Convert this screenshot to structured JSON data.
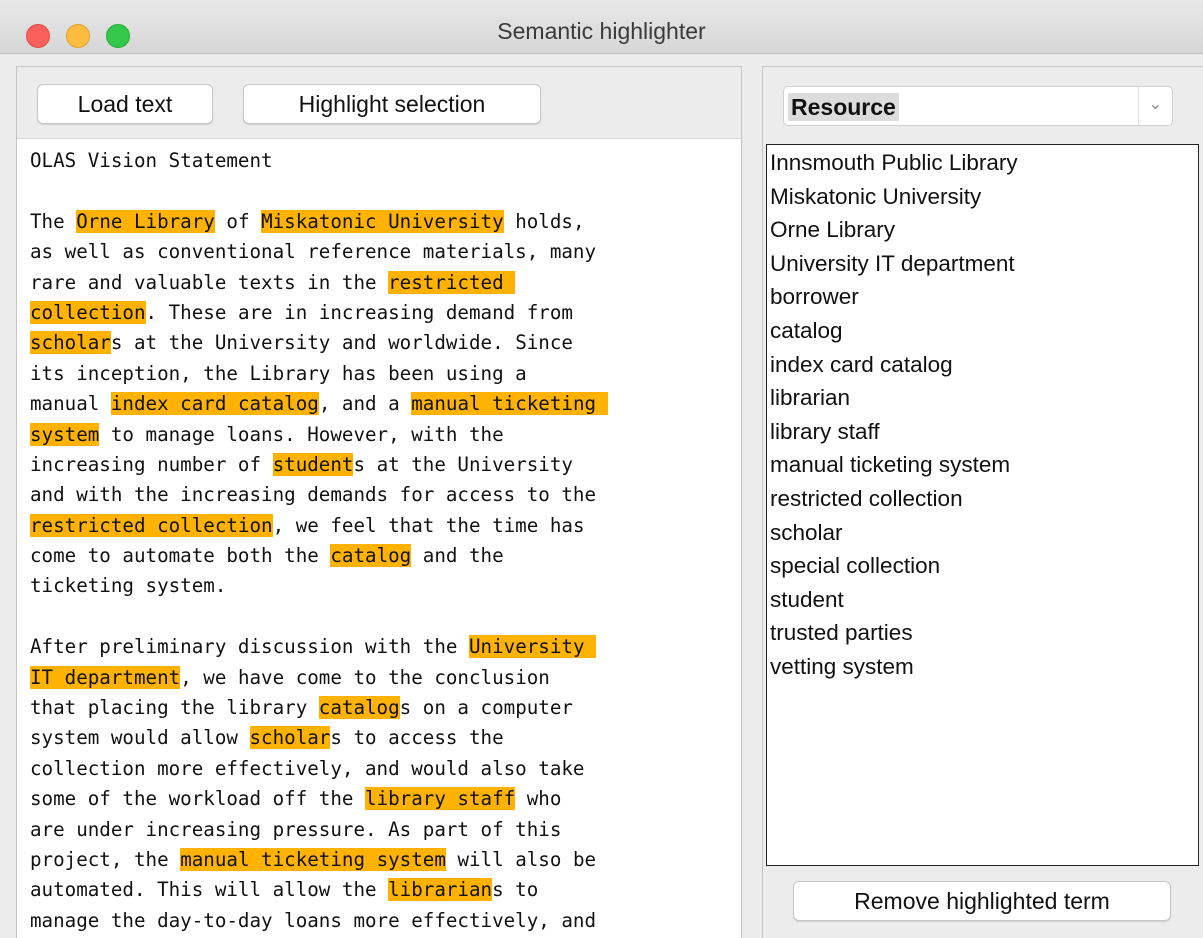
{
  "window": {
    "title": "Semantic highlighter"
  },
  "toolbar": {
    "load_label": "Load text",
    "highlight_label": "Highlight selection"
  },
  "document": {
    "highlight_color": "#ffb300",
    "lines": [
      [
        {
          "t": "OLAS Vision Statement",
          "h": false
        }
      ],
      [
        {
          "t": "",
          "h": false
        }
      ],
      [
        {
          "t": "The ",
          "h": false
        },
        {
          "t": "Orne Library",
          "h": true
        },
        {
          "t": " of ",
          "h": false
        },
        {
          "t": "Miskatonic University",
          "h": true
        },
        {
          "t": " holds,",
          "h": false
        }
      ],
      [
        {
          "t": "as well as conventional reference materials, many",
          "h": false
        }
      ],
      [
        {
          "t": "rare and valuable texts in the ",
          "h": false
        },
        {
          "t": "restricted ",
          "h": true
        }
      ],
      [
        {
          "t": "collection",
          "h": true
        },
        {
          "t": ". These are in increasing demand from",
          "h": false
        }
      ],
      [
        {
          "t": "scholar",
          "h": true
        },
        {
          "t": "s at the University and worldwide. Since",
          "h": false
        }
      ],
      [
        {
          "t": "its inception, the Library has been using a",
          "h": false
        }
      ],
      [
        {
          "t": "manual ",
          "h": false
        },
        {
          "t": "index card catalog",
          "h": true
        },
        {
          "t": ", and a ",
          "h": false
        },
        {
          "t": "manual ticketing ",
          "h": true
        }
      ],
      [
        {
          "t": "system",
          "h": true
        },
        {
          "t": " to manage loans. However, with the",
          "h": false
        }
      ],
      [
        {
          "t": "increasing number of ",
          "h": false
        },
        {
          "t": "student",
          "h": true
        },
        {
          "t": "s at the University",
          "h": false
        }
      ],
      [
        {
          "t": "and with the increasing demands for access to the",
          "h": false
        }
      ],
      [
        {
          "t": "restricted collection",
          "h": true
        },
        {
          "t": ", we feel that the time has",
          "h": false
        }
      ],
      [
        {
          "t": "come to automate both the ",
          "h": false
        },
        {
          "t": "catalog",
          "h": true
        },
        {
          "t": " and the",
          "h": false
        }
      ],
      [
        {
          "t": "ticketing system.",
          "h": false
        }
      ],
      [
        {
          "t": "",
          "h": false
        }
      ],
      [
        {
          "t": "After preliminary discussion with the ",
          "h": false
        },
        {
          "t": "University ",
          "h": true
        }
      ],
      [
        {
          "t": "IT department",
          "h": true
        },
        {
          "t": ", we have come to the conclusion",
          "h": false
        }
      ],
      [
        {
          "t": "that placing the library ",
          "h": false
        },
        {
          "t": "catalog",
          "h": true
        },
        {
          "t": "s on a computer",
          "h": false
        }
      ],
      [
        {
          "t": "system would allow ",
          "h": false
        },
        {
          "t": "scholar",
          "h": true
        },
        {
          "t": "s to access the",
          "h": false
        }
      ],
      [
        {
          "t": "collection more effectively, and would also take",
          "h": false
        }
      ],
      [
        {
          "t": "some of the workload off the ",
          "h": false
        },
        {
          "t": "library staff",
          "h": true
        },
        {
          "t": " who",
          "h": false
        }
      ],
      [
        {
          "t": "are under increasing pressure. As part of this",
          "h": false
        }
      ],
      [
        {
          "t": "project, the ",
          "h": false
        },
        {
          "t": "manual ticketing system",
          "h": true
        },
        {
          "t": " will also be",
          "h": false
        }
      ],
      [
        {
          "t": "automated. This will allow the ",
          "h": false
        },
        {
          "t": "librarian",
          "h": true
        },
        {
          "t": "s to",
          "h": false
        }
      ],
      [
        {
          "t": "manage the day-to-day loans more effectively, and",
          "h": false
        }
      ]
    ]
  },
  "category": {
    "selected": "Resource",
    "arrow_icon": "chevron-down-icon"
  },
  "terms": [
    "Innsmouth Public Library",
    "Miskatonic University",
    "Orne Library",
    "University IT department",
    "borrower",
    "catalog",
    "index card catalog",
    "librarian",
    "library staff",
    "manual ticketing system",
    "restricted collection",
    "scholar",
    "special collection",
    "student",
    "trusted parties",
    "vetting system"
  ],
  "remove_label": "Remove highlighted term"
}
